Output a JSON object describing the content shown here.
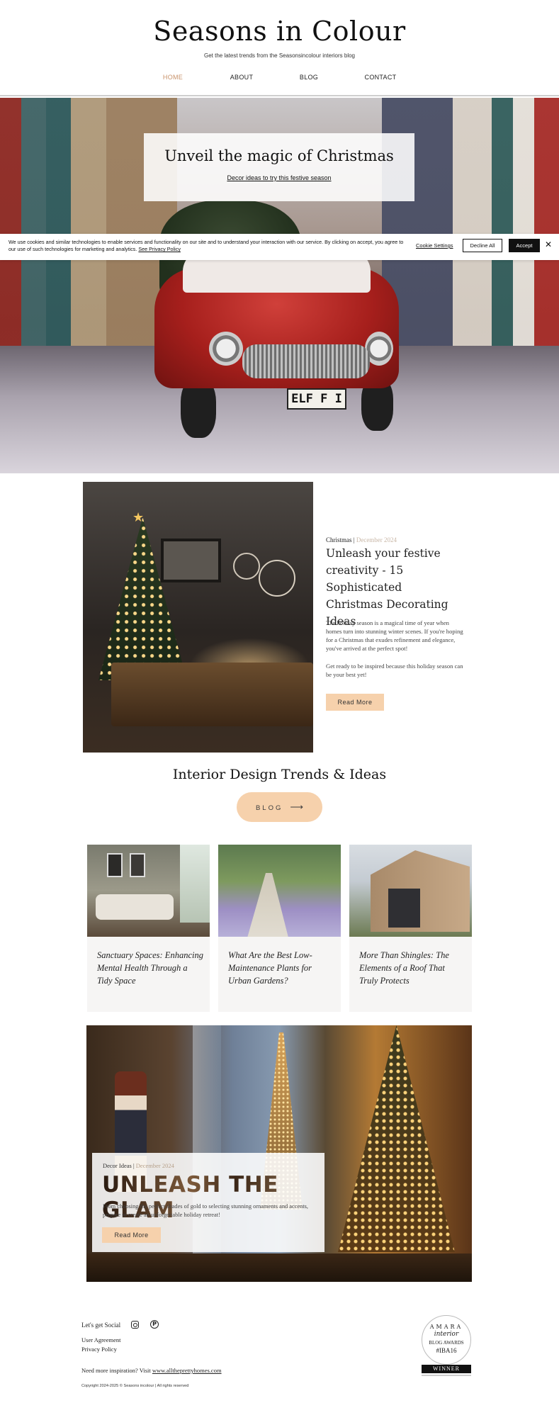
{
  "header": {
    "site_title": "Seasons in Colour",
    "tagline": "Get the latest trends from the Seasonsincolour interiors blog",
    "nav": {
      "home": "HOME",
      "about": "ABOUT",
      "blog": "BLOG",
      "contact": "CONTACT",
      "active_color": "#c8926a"
    }
  },
  "hero": {
    "heading": "Unveil the magic of Christmas",
    "link": "Decor ideas to try this festive season",
    "plate_text": "ELF F I"
  },
  "cookie_banner": {
    "text": "We use cookies and similar technologies to enable services and functionality on our site and to understand your interaction with our service. By clicking on accept, you agree to our use of such technologies for marketing and analytics.",
    "privacy_link": "See Privacy Policy",
    "settings": "Cookie Settings",
    "decline": "Decline All",
    "accept": "Accept",
    "close_icon": "close-icon"
  },
  "featured": {
    "category": "Christmas",
    "separator": "|",
    "date": "December 2024",
    "title": "Unleash your festive creativity - 15 Sophisticated Christmas Decorating Ideas",
    "excerpt1": "The holiday season is a magical time of year when homes turn into stunning winter scenes. If you're hoping for a Christmas that exudes refinement and elegance, you've arrived at the perfect spot!",
    "excerpt2": "Get ready to be inspired because this holiday season can be your best yet!",
    "button": "Read More"
  },
  "trends": {
    "heading": "Interior Design Trends & Ideas",
    "button": "BLOG",
    "arrow": "⟶"
  },
  "cards": [
    {
      "title": "Sanctuary Spaces: Enhancing Mental Health Through a Tidy Space"
    },
    {
      "title": "What Are the Best Low-Maintenance Plants for Urban Gardens?"
    },
    {
      "title": "More Than Shingles: The Elements of a Roof That Truly Protects"
    }
  ],
  "promo": {
    "category": "Decor Ideas",
    "separator": "|",
    "date": "December 2024",
    "title": "UNLEASH THE GLAM",
    "excerpt": "From choosing the perfect shades of gold to selecting stunning ornaments and accents, prepare to create an unforgettable holiday retreat!",
    "button": "Read More"
  },
  "footer": {
    "social_label": "Let's get Social",
    "instagram_icon": "instagram-icon",
    "pinterest_icon": "pinterest-icon",
    "pinterest_glyph": "P",
    "user_agreement": "User Agreement",
    "privacy_policy": "Privacy Policy",
    "inspiration_prefix": "Need more inspiration? Visit",
    "inspiration_link": "www.alltheprettyhomes.com",
    "copyright": "Copyright 2024-2025 © Seasons incolour | All rights reserved"
  },
  "award_badge": {
    "line1": "AMARA",
    "line2": "interior",
    "line3": "BLOG AWARDS",
    "line4": "#IBA16",
    "winner": "WINNER"
  },
  "colors": {
    "accent_peach": "#f6d1ac",
    "nav_active": "#c8926a",
    "text_dark": "#111111",
    "card_bg": "#f6f5f4"
  }
}
